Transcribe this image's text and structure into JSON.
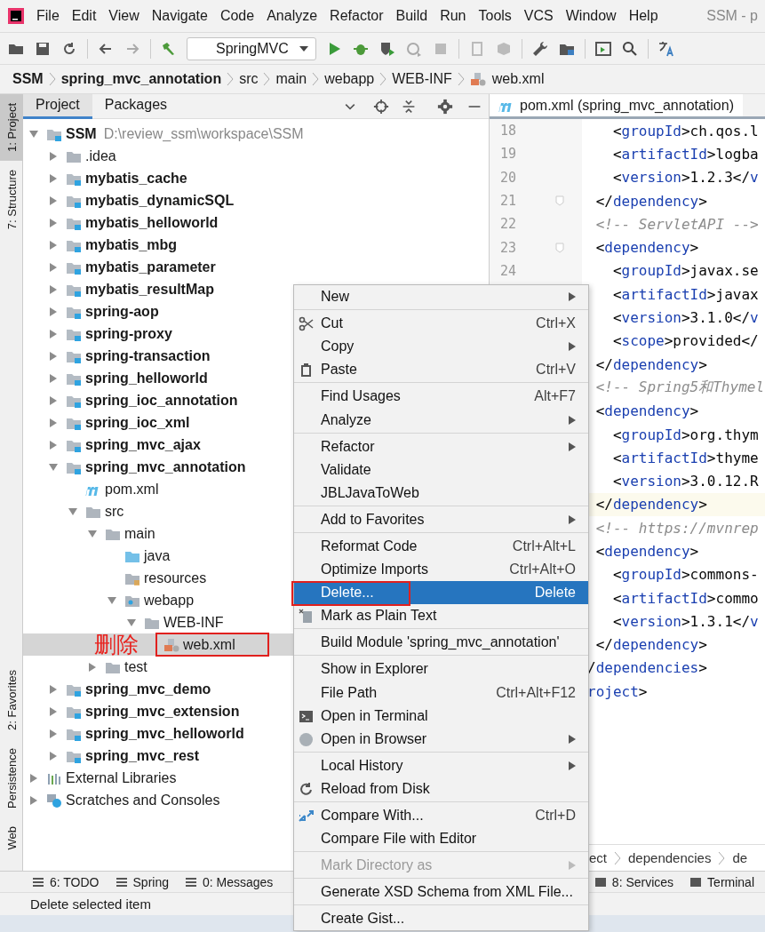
{
  "menu_bar": {
    "items": [
      "File",
      "Edit",
      "View",
      "Navigate",
      "Code",
      "Analyze",
      "Refactor",
      "Build",
      "Run",
      "Tools",
      "VCS",
      "Window",
      "Help"
    ],
    "title": "SSM - p"
  },
  "toolbar": {
    "run_config": "SpringMVC"
  },
  "breadcrumb": [
    {
      "label": "SSM",
      "bold": true
    },
    {
      "label": "spring_mvc_annotation",
      "bold": true
    },
    {
      "label": "src",
      "bold": false
    },
    {
      "label": "main",
      "bold": false
    },
    {
      "label": "webapp",
      "bold": false
    },
    {
      "label": "WEB-INF",
      "bold": false
    },
    {
      "label": "web.xml",
      "bold": false,
      "kind": "xml"
    }
  ],
  "left_strip": {
    "top": [
      {
        "label": "1: Project",
        "selected": true
      },
      {
        "label": "7: Structure",
        "selected": false
      }
    ],
    "bottom": [
      {
        "label": "2: Favorites",
        "selected": false
      },
      {
        "label": "Persistence",
        "selected": false
      },
      {
        "label": "Web",
        "selected": false
      }
    ]
  },
  "project_panel": {
    "tabs": [
      {
        "label": "Project",
        "selected": true
      },
      {
        "label": "Packages",
        "selected": false
      }
    ],
    "tree": [
      {
        "label": "SSM",
        "path": "D:\\review_ssm\\workspace\\SSM",
        "kind": "root",
        "expanded": true,
        "selected": false,
        "children": [
          {
            "label": ".idea",
            "kind": "folder",
            "expanded": false,
            "selected": false
          },
          {
            "label": "mybatis_cache",
            "kind": "module",
            "expanded": false,
            "selected": false
          },
          {
            "label": "mybatis_dynamicSQL",
            "kind": "module",
            "expanded": false,
            "selected": false
          },
          {
            "label": "mybatis_helloworld",
            "kind": "module",
            "expanded": false,
            "selected": false
          },
          {
            "label": "mybatis_mbg",
            "kind": "module",
            "expanded": false,
            "selected": false
          },
          {
            "label": "mybatis_parameter",
            "kind": "module",
            "expanded": false,
            "selected": false
          },
          {
            "label": "mybatis_resultMap",
            "kind": "module",
            "expanded": false,
            "selected": false
          },
          {
            "label": "spring-aop",
            "kind": "module",
            "expanded": false,
            "selected": false
          },
          {
            "label": "spring-proxy",
            "kind": "module",
            "expanded": false,
            "selected": false
          },
          {
            "label": "spring-transaction",
            "kind": "module",
            "expanded": false,
            "selected": false
          },
          {
            "label": "spring_helloworld",
            "kind": "module",
            "expanded": false,
            "selected": false
          },
          {
            "label": "spring_ioc_annotation",
            "kind": "module",
            "expanded": false,
            "selected": false
          },
          {
            "label": "spring_ioc_xml",
            "kind": "module",
            "expanded": false,
            "selected": false
          },
          {
            "label": "spring_mvc_ajax",
            "kind": "module",
            "expanded": false,
            "selected": false
          },
          {
            "label": "spring_mvc_annotation",
            "kind": "module",
            "expanded": true,
            "selected": false,
            "children": [
              {
                "label": "pom.xml",
                "kind": "maven",
                "selected": false
              },
              {
                "label": "src",
                "kind": "folder",
                "expanded": true,
                "selected": false,
                "children": [
                  {
                    "label": "main",
                    "kind": "folder",
                    "expanded": true,
                    "selected": false,
                    "children": [
                      {
                        "label": "java",
                        "kind": "source",
                        "selected": false
                      },
                      {
                        "label": "resources",
                        "kind": "resources",
                        "selected": false
                      },
                      {
                        "label": "webapp",
                        "kind": "webapp",
                        "expanded": true,
                        "selected": false,
                        "children": [
                          {
                            "label": "WEB-INF",
                            "kind": "folder",
                            "expanded": true,
                            "selected": false,
                            "children": [
                              {
                                "label": "web.xml",
                                "kind": "xml",
                                "selected": true,
                                "boxed": true,
                                "annotation": "删除"
                              }
                            ]
                          }
                        ]
                      }
                    ]
                  },
                  {
                    "label": "test",
                    "kind": "folder",
                    "expanded": false,
                    "selected": false
                  }
                ]
              }
            ]
          },
          {
            "label": "spring_mvc_demo",
            "kind": "module",
            "expanded": false,
            "selected": false
          },
          {
            "label": "spring_mvc_extension",
            "kind": "module",
            "expanded": false,
            "selected": false
          },
          {
            "label": "spring_mvc_helloworld",
            "kind": "module",
            "expanded": false,
            "selected": false
          },
          {
            "label": "spring_mvc_rest",
            "kind": "module",
            "expanded": false,
            "selected": false
          }
        ]
      },
      {
        "label": "External Libraries",
        "kind": "libraries",
        "expanded": false,
        "selected": false
      },
      {
        "label": "Scratches and Consoles",
        "kind": "scratches",
        "expanded": false,
        "selected": false
      }
    ]
  },
  "editor": {
    "tab": "pom.xml (spring_mvc_annotation)",
    "lines": [
      {
        "number": "18",
        "text": "   <groupId>ch.qos.l",
        "kind": "code"
      },
      {
        "number": "19",
        "text": "   <artifactId>logba",
        "kind": "code"
      },
      {
        "number": "20",
        "text": "   <version>1.2.3</v",
        "kind": "code"
      },
      {
        "number": "21",
        "text": " </dependency>",
        "kind": "code",
        "fold": true
      },
      {
        "number": "22",
        "text": " <!-- ServletAPI -->",
        "kind": "comment"
      },
      {
        "number": "23",
        "text": " <dependency>",
        "kind": "code",
        "fold": true
      },
      {
        "number": "24",
        "text": "   <groupId>javax.se",
        "kind": "code"
      },
      {
        "text": "   <artifactId>javax",
        "kind": "code"
      },
      {
        "text": "   <version>3.1.0</v",
        "kind": "code"
      },
      {
        "text": "   <scope>provided</",
        "kind": "code"
      },
      {
        "text": " </dependency>",
        "kind": "code"
      },
      {
        "text": " <!-- Spring5和Thymel",
        "kind": "comment"
      },
      {
        "text": " <dependency>",
        "kind": "code"
      },
      {
        "text": "   <groupId>org.thym",
        "kind": "code"
      },
      {
        "text": "   <artifactId>thyme",
        "kind": "code"
      },
      {
        "text": "   <version>3.0.12.R",
        "kind": "code"
      },
      {
        "text": " </dependency>",
        "kind": "code",
        "current": true
      },
      {
        "text": " <!-- https://mvnrep",
        "kind": "comment"
      },
      {
        "text": " <dependency>",
        "kind": "code"
      },
      {
        "text": "   <groupId>commons-",
        "kind": "code"
      },
      {
        "text": "   <artifactId>commo",
        "kind": "code"
      },
      {
        "text": "   <version>1.3.1</v",
        "kind": "code"
      },
      {
        "text": " </dependency>",
        "kind": "code"
      },
      {
        "text": "/dependencies>",
        "kind": "code"
      },
      {
        "text": "roject>",
        "kind": "code"
      }
    ],
    "breadcrumb": [
      "ect",
      "dependencies",
      "de"
    ]
  },
  "context_menu": [
    {
      "kind": "item",
      "label": "New",
      "submenu": true
    },
    {
      "kind": "separator"
    },
    {
      "kind": "item",
      "label": "Cut",
      "shortcut": "Ctrl+X"
    },
    {
      "kind": "item",
      "label": "Copy",
      "submenu": true
    },
    {
      "kind": "item",
      "label": "Paste",
      "shortcut": "Ctrl+V"
    },
    {
      "kind": "separator"
    },
    {
      "kind": "item",
      "label": "Find Usages",
      "shortcut": "Alt+F7"
    },
    {
      "kind": "item",
      "label": "Analyze",
      "submenu": true
    },
    {
      "kind": "separator"
    },
    {
      "kind": "item",
      "label": "Refactor",
      "submenu": true
    },
    {
      "kind": "item",
      "label": "Validate"
    },
    {
      "kind": "item",
      "label": "JBLJavaToWeb"
    },
    {
      "kind": "separator"
    },
    {
      "kind": "item",
      "label": "Add to Favorites",
      "submenu": true
    },
    {
      "kind": "separator"
    },
    {
      "kind": "item",
      "label": "Reformat Code",
      "shortcut": "Ctrl+Alt+L"
    },
    {
      "kind": "item",
      "label": "Optimize Imports",
      "shortcut": "Ctrl+Alt+O"
    },
    {
      "kind": "item",
      "label": "Delete...",
      "shortcut": "Delete",
      "selected": true,
      "boxed": true
    },
    {
      "kind": "item",
      "label": "Mark as Plain Text"
    },
    {
      "kind": "separator"
    },
    {
      "kind": "item",
      "label": "Build Module 'spring_mvc_annotation'"
    },
    {
      "kind": "separator"
    },
    {
      "kind": "item",
      "label": "Show in Explorer"
    },
    {
      "kind": "item",
      "label": "File Path",
      "shortcut": "Ctrl+Alt+F12"
    },
    {
      "kind": "item",
      "label": "Open in Terminal"
    },
    {
      "kind": "item",
      "label": "Open in Browser",
      "submenu": true
    },
    {
      "kind": "separator"
    },
    {
      "kind": "item",
      "label": "Local History",
      "submenu": true
    },
    {
      "kind": "item",
      "label": "Reload from Disk"
    },
    {
      "kind": "separator"
    },
    {
      "kind": "item",
      "label": "Compare With...",
      "shortcut": "Ctrl+D"
    },
    {
      "kind": "item",
      "label": "Compare File with Editor"
    },
    {
      "kind": "separator"
    },
    {
      "kind": "item",
      "label": "Mark Directory as",
      "submenu": true,
      "disabled": true
    },
    {
      "kind": "separator"
    },
    {
      "kind": "item",
      "label": "Generate XSD Schema from XML File..."
    },
    {
      "kind": "separator"
    },
    {
      "kind": "item",
      "label": "Create Gist..."
    }
  ],
  "bottom_tools": {
    "left": [
      "6: TODO",
      "Spring",
      "0: Messages"
    ],
    "right": [
      "8: Services",
      "Terminal"
    ]
  },
  "status_bar": "Delete selected item"
}
